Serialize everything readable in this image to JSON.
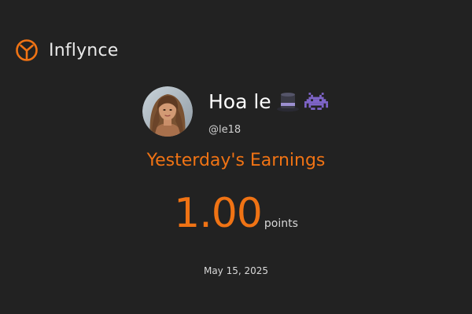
{
  "brand": {
    "name": "Inflynce",
    "logo_icon": "y-ring-logo-icon",
    "accent": "#f07314"
  },
  "profile": {
    "display_name": "Hoa le",
    "handle": "@le18",
    "avatar": "profile-photo",
    "badges": [
      "top-hat-icon",
      "space-invader-icon"
    ]
  },
  "earnings": {
    "title": "Yesterday's Earnings",
    "value": "1.00",
    "unit": "points",
    "date": "May 15, 2025"
  },
  "colors": {
    "background": "#222222",
    "accent": "#f07314",
    "text": "#ffffff"
  }
}
